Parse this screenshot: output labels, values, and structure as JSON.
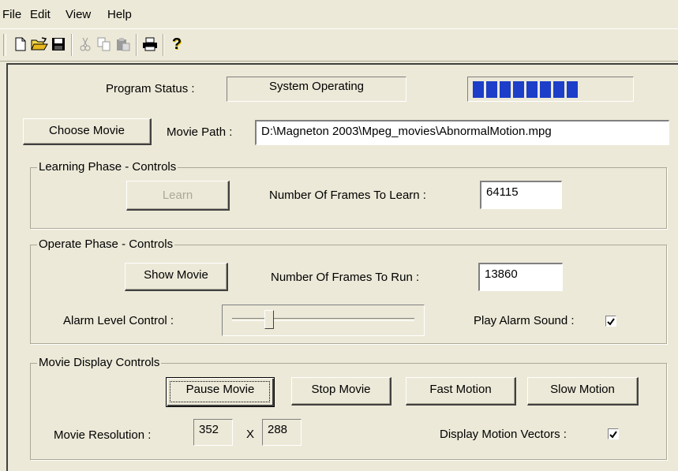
{
  "menu": {
    "file": "File",
    "edit": "Edit",
    "view": "View",
    "help": "Help"
  },
  "toolbar": {
    "icons": [
      "new-icon",
      "open-icon",
      "save-icon",
      "cut-icon",
      "copy-icon",
      "paste-icon",
      "print-icon",
      "help-icon"
    ],
    "help_glyph": "?"
  },
  "status": {
    "label": "Program Status :",
    "value": "System Operating",
    "progress_filled_cells": 8,
    "progress_color": "#1c3ec8"
  },
  "movie": {
    "choose_button": "Choose Movie",
    "path_label": "Movie Path :",
    "path_value": "D:\\Magneton 2003\\Mpeg_movies\\AbnormalMotion.mpg"
  },
  "learning": {
    "title": "Learning Phase - Controls",
    "learn_button": "Learn",
    "frames_label": "Number Of Frames To Learn :",
    "frames_value": "64115"
  },
  "operate": {
    "title": "Operate Phase -  Controls",
    "show_button": "Show Movie",
    "frames_label": "Number Of Frames To Run :",
    "frames_value": "13860",
    "alarm_label": "Alarm Level Control :",
    "alarm_level": 0.2,
    "sound_label": "Play Alarm Sound :",
    "sound_checked": true
  },
  "display": {
    "title": "Movie Display Controls",
    "pause_button": "Pause Movie",
    "stop_button": "Stop Movie",
    "fast_button": "Fast Motion",
    "slow_button": "Slow Motion",
    "resolution_label": "Movie Resolution :",
    "res_width": "352",
    "res_x": "X",
    "res_height": "288",
    "vectors_label": "Display Motion Vectors :",
    "vectors_checked": true
  }
}
